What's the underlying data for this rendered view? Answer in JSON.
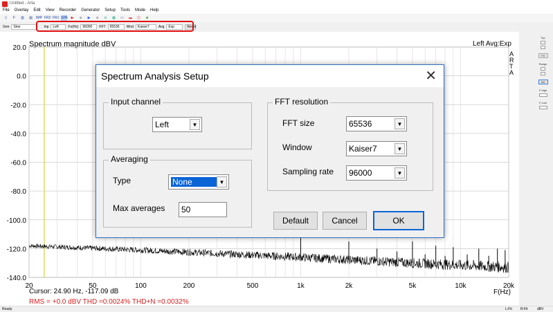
{
  "window": {
    "title": "Untitled - Arta"
  },
  "menu": [
    "File",
    "Overlay",
    "Edit",
    "View",
    "Recorder",
    "Generator",
    "Setup",
    "Tools",
    "Mode",
    "Help"
  ],
  "toolbar": {
    "buttons": [
      "IMP",
      "FR2",
      "FR1",
      "SPA"
    ]
  },
  "toolbar2": {
    "gen_label": "Gen",
    "gen_value": "Sine",
    "inp_label": "Inp",
    "inp_value": "Left",
    "fs_label": "Fs(Hz)",
    "fs_value": "96000",
    "fft_label": "FFT",
    "fft_value": "65536",
    "wnd_label": "Wnd",
    "wnd_value": "Kaiser7",
    "avg_label": "Avg",
    "avg_value": "Exp",
    "reset_label": "Reset"
  },
  "plot": {
    "title": "Spectrum magnitude dBV",
    "top_right": "Left  Avg:Exp",
    "watermark": "ARTA",
    "cursor": "Cursor: 24.90 Hz, -117.09 dB",
    "stats": "RMS =   +0.0 dBV  THD =0.0024%  THD+N =0.0032%",
    "xlabel": "F(Hz)"
  },
  "chart_data": {
    "type": "line",
    "xscale": "log",
    "xlim": [
      20,
      20000
    ],
    "ylim": [
      -140,
      20
    ],
    "grid": true,
    "yticks": [
      "20.0",
      "0.0",
      "-20.0",
      "-40.0",
      "-60.0",
      "-80.0",
      "-100.0",
      "-120.0",
      "-140.0"
    ],
    "xticks": [
      {
        "v": 20,
        "t": "20"
      },
      {
        "v": 50,
        "t": "50"
      },
      {
        "v": 100,
        "t": "100"
      },
      {
        "v": 200,
        "t": "200"
      },
      {
        "v": 500,
        "t": "500"
      },
      {
        "v": 1000,
        "t": "1k"
      },
      {
        "v": 2000,
        "t": "2k"
      },
      {
        "v": 5000,
        "t": "5k"
      },
      {
        "v": 10000,
        "t": "10k"
      },
      {
        "v": 20000,
        "t": "20k"
      }
    ],
    "noise_floor": [
      [
        20,
        -118
      ],
      [
        100,
        -121
      ],
      [
        1000,
        -126
      ],
      [
        5000,
        -130
      ],
      [
        20000,
        -133
      ]
    ],
    "harmonics": [
      [
        1000,
        0
      ],
      [
        2000,
        -115
      ],
      [
        3000,
        -120
      ],
      [
        4000,
        -122
      ],
      [
        5000,
        -115
      ],
      [
        6000,
        -124
      ],
      [
        7000,
        -118
      ],
      [
        8000,
        -125
      ],
      [
        9000,
        -119
      ],
      [
        11000,
        -124
      ],
      [
        13000,
        -120
      ],
      [
        15000,
        -125
      ],
      [
        17000,
        -120
      ],
      [
        19000,
        -121
      ]
    ],
    "cursor_hz": 24.9
  },
  "right_panel": {
    "top": "Top",
    "fit": "Fit",
    "range": "Range",
    "set": "Set",
    "fhigh": "F-high",
    "flow": "F-Low"
  },
  "status": {
    "left": "Ready",
    "r1": "L:Fit",
    "r2": "R:Fit",
    "r3": "dBV"
  },
  "dialog": {
    "title": "Spectrum Analysis Setup",
    "input_channel": "Input channel",
    "channel": "Left",
    "averaging": "Averaging",
    "type_label": "Type",
    "type_value": "None",
    "max_avg_label": "Max averages",
    "max_avg_value": "50",
    "fft_resolution": "FFT resolution",
    "fft_size_label": "FFT size",
    "fft_size": "65536",
    "window_label": "Window",
    "window": "Kaiser7",
    "sr_label": "Sampling rate",
    "sr": "96000",
    "default": "Default",
    "cancel": "Cancel",
    "ok": "OK"
  }
}
